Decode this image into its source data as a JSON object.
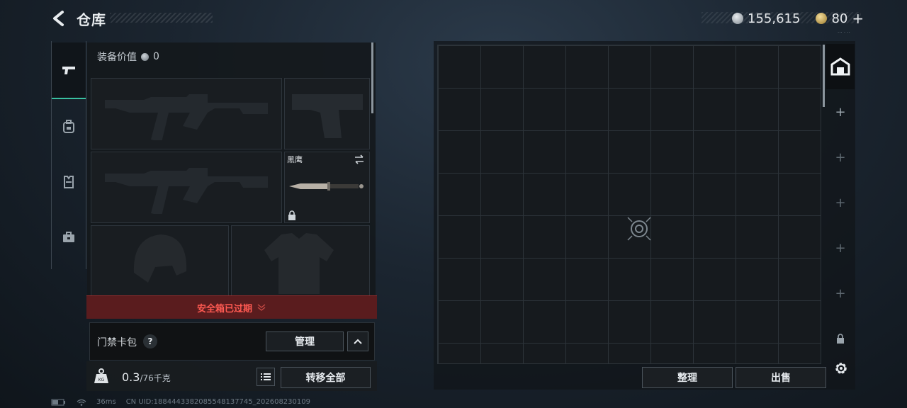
{
  "header": {
    "title": "仓库",
    "silver_amount": "155,615",
    "gold_amount": "80",
    "add_symbol": "+",
    "tiny_text": "··· · ··"
  },
  "colors": {
    "accent": "#39c0a0",
    "expired_red": "#ff5a52",
    "banner_bg": "#5a1c1e"
  },
  "side_tabs": [
    {
      "icon": "pistol-icon",
      "selected": true
    },
    {
      "icon": "backpack-icon",
      "selected": false
    },
    {
      "icon": "vest-icon",
      "selected": false
    },
    {
      "icon": "briefcase-icon",
      "selected": false
    }
  ],
  "loadout": {
    "value_label": "装备价值",
    "value": "0",
    "knife_name": "黑鹰",
    "slots": [
      "primary-rifle-slot",
      "pistol-slot",
      "secondary-rifle-slot",
      "melee-slot",
      "helmet-slot",
      "armor-slot"
    ]
  },
  "safe_box": {
    "expired_text": "安全箱已过期"
  },
  "card_pack": {
    "label": "门禁卡包",
    "help": "?",
    "manage_label": "管理"
  },
  "weight": {
    "current": "0.3",
    "max": "/76千克"
  },
  "actions": {
    "transfer_all": "转移全部",
    "organize": "整理",
    "sell": "出售"
  },
  "status_bar": {
    "ping": "36ms",
    "uid": "CN UID:1884443382085548137745_202608230109"
  },
  "right_strip": [
    "+",
    "+",
    "+",
    "+",
    "+"
  ]
}
